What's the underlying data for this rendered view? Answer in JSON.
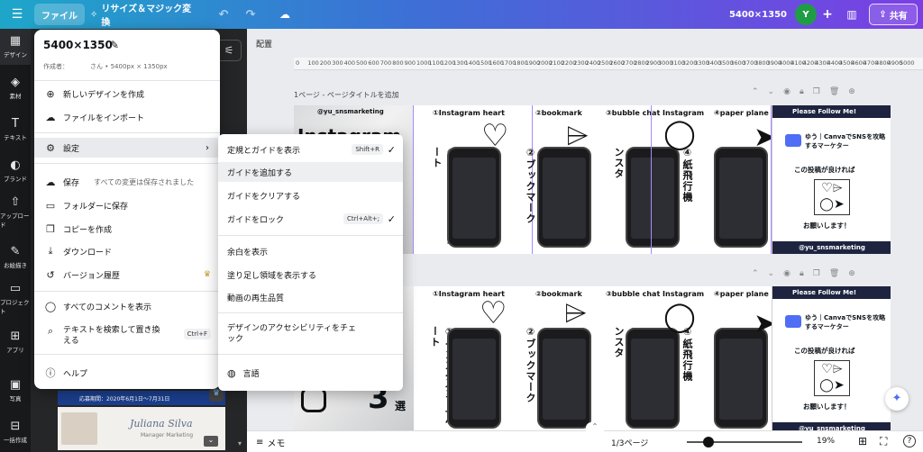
{
  "topbar": {
    "file": "ファイル",
    "resize": "リサイズ＆マジック変換",
    "size": "5400×1350",
    "avatar": "Y",
    "share": "共有"
  },
  "sidebar": [
    {
      "label": "デザイン",
      "icon": "design-icon"
    },
    {
      "label": "素材",
      "icon": "elements-icon"
    },
    {
      "label": "テキスト",
      "icon": "text-icon"
    },
    {
      "label": "ブランド",
      "icon": "brand-icon"
    },
    {
      "label": "アップロード",
      "icon": "upload-icon"
    },
    {
      "label": "お絵描き",
      "icon": "draw-icon"
    },
    {
      "label": "プロジェクト",
      "icon": "projects-icon"
    },
    {
      "label": "アプリ",
      "icon": "apps-icon"
    },
    {
      "label": "写真",
      "icon": "photos-icon"
    },
    {
      "label": "一括作成",
      "icon": "bulk-create-icon"
    }
  ],
  "menu": {
    "title": "5400×1350",
    "creator_label": "作成者：",
    "creator_value": "さん • 5400px × 1350px",
    "items": [
      {
        "label": "新しいデザインを作成",
        "icon": "add-design-icon"
      },
      {
        "label": "ファイルをインポート",
        "icon": "import-icon"
      },
      {
        "label": "設定",
        "icon": "gear-icon"
      },
      {
        "label": "保存",
        "icon": "save-icon",
        "note": "すべての変更は保存されました"
      },
      {
        "label": "フォルダーに保存",
        "icon": "folder-icon"
      },
      {
        "label": "コピーを作成",
        "icon": "copy-icon"
      },
      {
        "label": "ダウンロード",
        "icon": "download-icon"
      },
      {
        "label": "バージョン履歴",
        "icon": "history-icon"
      },
      {
        "label": "すべてのコメントを表示",
        "icon": "comment-icon"
      },
      {
        "label": "テキストを検索して置き換える",
        "icon": "search-icon",
        "shortcut": "Ctrl+F"
      },
      {
        "label": "ヘルプ",
        "icon": "help-icon"
      }
    ]
  },
  "submenu": {
    "items": [
      {
        "label": "定規とガイドを表示",
        "shortcut": "Shift+R",
        "checked": true
      },
      {
        "label": "ガイドを追加する"
      },
      {
        "label": "ガイドをクリアする"
      },
      {
        "label": "ガイドをロック",
        "shortcut": "Ctrl+Alt+;",
        "checked": true
      },
      {
        "label": "余白を表示"
      },
      {
        "label": "塗り足し領域を表示する"
      },
      {
        "label": "動画の再生品質"
      },
      {
        "label": "デザインのアクセシビリティをチェック"
      },
      {
        "label": "言語",
        "icon": "globe-icon"
      }
    ]
  },
  "workspace": {
    "arrange": "配置",
    "page1_title": "1ページ - ページタイトルを追加",
    "ruler": [
      "0",
      "100",
      "200",
      "300",
      "400",
      "500",
      "600",
      "700",
      "800",
      "900",
      "1000",
      "1100",
      "1200",
      "1300",
      "1400",
      "1500",
      "1600",
      "1700",
      "1800",
      "1900",
      "2000",
      "2100",
      "2200",
      "2300",
      "2400",
      "2500",
      "2600",
      "2700",
      "2800",
      "2900",
      "3000",
      "3100",
      "3200",
      "3300",
      "3400",
      "3500",
      "3600",
      "3700",
      "3800",
      "3900",
      "4000",
      "4100",
      "4200",
      "4300",
      "4400",
      "4500",
      "4600",
      "4700",
      "4800",
      "4900",
      "5000"
    ]
  },
  "design": {
    "handle": "@yu_sns​marketing",
    "insta_word": "Instagram",
    "s1_title": "①Instagram heart",
    "s1_vert": "①インスタグラムハート",
    "s2_title": "②bookmark",
    "s2_vert": "②ブックマーク",
    "s3_title": "③bubble chat Instagram",
    "s3_vert": "③バブルチャットインスタ",
    "s4_title": "④paper plane",
    "s4_vert": "④紙飛行機",
    "promo_header": "Please Follow Me!",
    "promo_name": "ゆう｜CanvaでSNSを攻略するマーケター",
    "promo_good": "この投稿が良ければ",
    "promo_ask": "お願いします！",
    "promo_footer": "@yu_sns​marketing",
    "three": "3",
    "sen": "選"
  },
  "panel": {
    "template_caption": "応募期間：2020年6月1日〜7月31日",
    "template_name": "Juliana Silva",
    "template_role": "Manager Marketing"
  },
  "bottom": {
    "memo": "メモ",
    "page": "1/3ページ",
    "zoom": "19%",
    "zoom_value": 19
  }
}
